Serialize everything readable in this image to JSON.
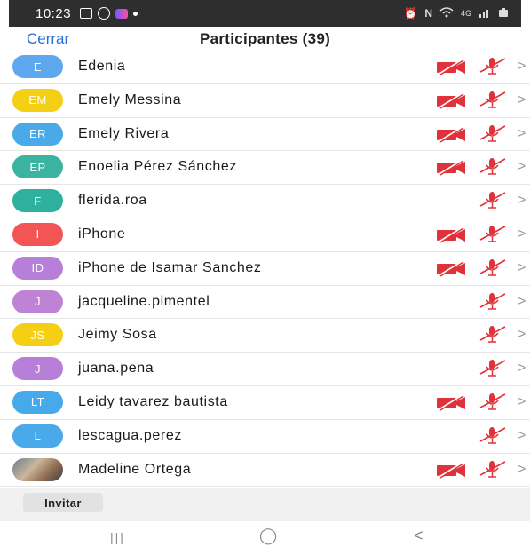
{
  "status_bar": {
    "time": "10:23",
    "left_icons": [
      "gallery-icon",
      "whatsapp-icon",
      "messenger-icon",
      "dot-icon"
    ],
    "right_icons": [
      "alarm-icon",
      "nfc-icon",
      "wifi-icon",
      "signal-icon",
      "battery-icon"
    ],
    "network_label": "4G"
  },
  "header": {
    "close_label": "Cerrar",
    "title": "Participantes (39)"
  },
  "participants": [
    {
      "initials": "E",
      "name": "Edenia",
      "color": "#5ea8f0",
      "video_off": true,
      "mic_off": true
    },
    {
      "initials": "EM",
      "name": "Emely Messina",
      "color": "#f5cf14",
      "video_off": true,
      "mic_off": true
    },
    {
      "initials": "ER",
      "name": "Emely Rivera",
      "color": "#4aa9e8",
      "video_off": true,
      "mic_off": true
    },
    {
      "initials": "EP",
      "name": "Enoelia Pérez Sánchez",
      "color": "#3bb3a1",
      "video_off": true,
      "mic_off": true
    },
    {
      "initials": "F",
      "name": "flerida.roa",
      "color": "#2fb09e",
      "video_off": false,
      "mic_off": true
    },
    {
      "initials": "I",
      "name": "iPhone",
      "color": "#f35454",
      "video_off": true,
      "mic_off": true
    },
    {
      "initials": "ID",
      "name": "iPhone de Isamar Sanchez",
      "color": "#b77fd8",
      "video_off": true,
      "mic_off": true
    },
    {
      "initials": "J",
      "name": "jacqueline.pimentel",
      "color": "#bf83d6",
      "video_off": false,
      "mic_off": true
    },
    {
      "initials": "JS",
      "name": "Jeimy Sosa",
      "color": "#f5cf14",
      "video_off": false,
      "mic_off": true
    },
    {
      "initials": "J",
      "name": "juana.pena",
      "color": "#b77fd8",
      "video_off": false,
      "mic_off": true
    },
    {
      "initials": "LT",
      "name": "Leidy tavarez bautista",
      "color": "#45a9ea",
      "video_off": true,
      "mic_off": true
    },
    {
      "initials": "L",
      "name": "lescagua.perez",
      "color": "#4aa9e8",
      "video_off": false,
      "mic_off": true
    },
    {
      "initials": "",
      "name": "Madeline Ortega",
      "color": "photo",
      "video_off": true,
      "mic_off": true
    }
  ],
  "footer": {
    "invite_label": "Invitar"
  },
  "navbar": {
    "recents": "|||",
    "home": "◯",
    "back": "<"
  },
  "colors": {
    "accent": "#2d6fd1",
    "muted_red": "#e0323a"
  }
}
